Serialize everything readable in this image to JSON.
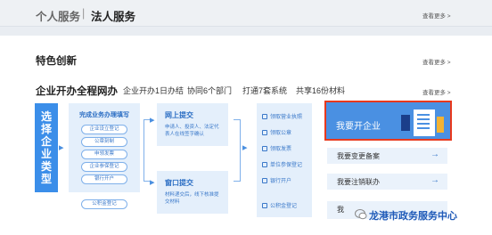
{
  "tabs": {
    "personal": "个人服务",
    "separator": "|",
    "corporate": "法人服务"
  },
  "more_label": "查看更多 >",
  "section1": {
    "title": "特色创新"
  },
  "section2": {
    "title": "企业开办全程网办",
    "subtitles": [
      "企业开办1日办结",
      "协同6个部门",
      "打通7套系统",
      "共享16份材料"
    ]
  },
  "flow": {
    "start": [
      "选",
      "择",
      "企",
      "业",
      "类",
      "型"
    ],
    "step1": {
      "header": "完成业务办理填写",
      "items": [
        "企业设立登记",
        "公章刻制",
        "申领发票",
        "企业参保登记",
        "银行开户",
        "公积金登记"
      ]
    },
    "online": {
      "header": "网上提交",
      "text": "申请人、投资人、法定代表人在线签字确认"
    },
    "window": {
      "header": "窗口提交",
      "text": "材料递交后，线下核准提交材料"
    },
    "results": [
      "领取营业执照",
      "领取公章",
      "领取发票",
      "单位参保登记",
      "银行开户",
      "公积金登记"
    ]
  },
  "actions": {
    "main": "我要开企业",
    "change": "我要变更备案",
    "cancel": "我要注销联办",
    "partial": "我"
  },
  "watermark": "龙港市政务服务中心"
}
